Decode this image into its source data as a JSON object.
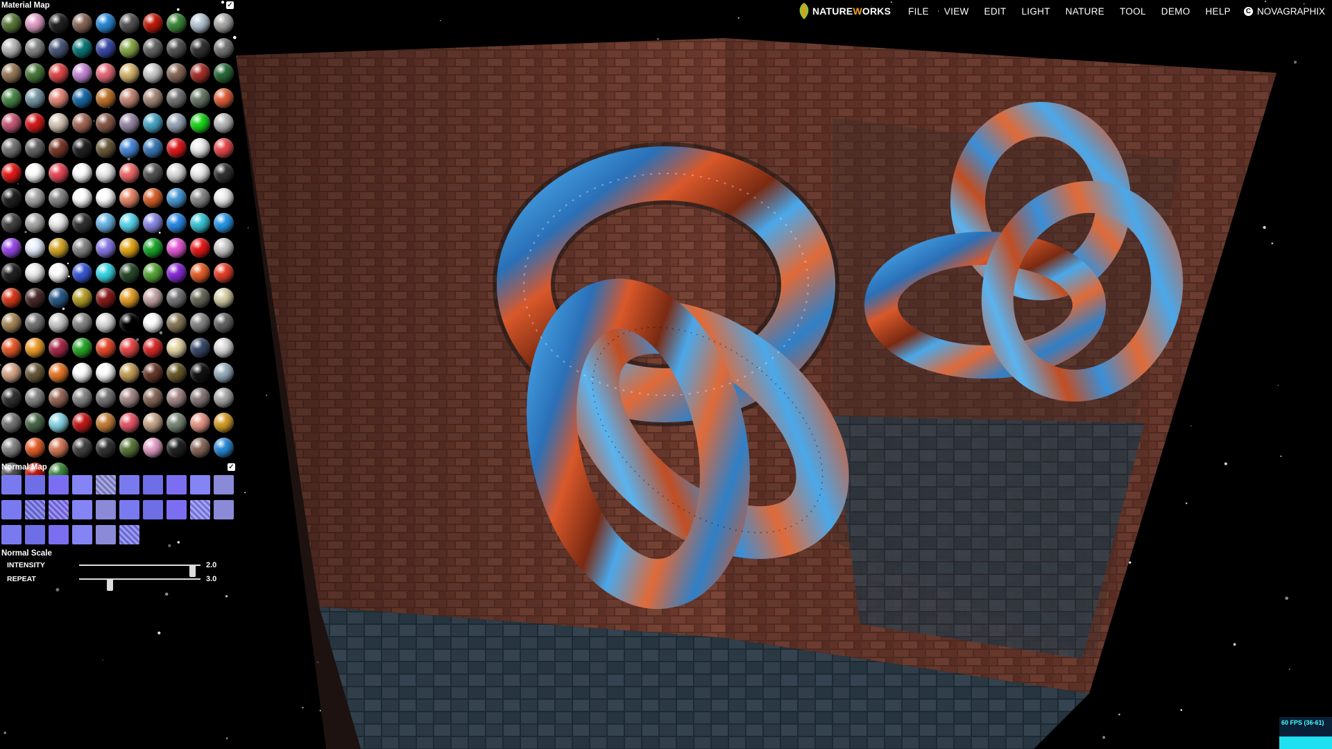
{
  "menu": {
    "logo_prefix": "N",
    "logo_mid": "ATURE",
    "logo_w": "W",
    "logo_end": "ORKS",
    "items": [
      "FILE",
      "VIEW",
      "EDIT",
      "LIGHT",
      "NATURE",
      "TOOL",
      "DEMO",
      "HELP"
    ],
    "brand": "NOVAGRAPHIX"
  },
  "material_map": {
    "title": "Material Map",
    "enabled": true,
    "count": 183
  },
  "normal_map": {
    "title": "Normal Map",
    "enabled": true,
    "count": 26
  },
  "normal_scale": {
    "title": "Normal Scale",
    "intensity": {
      "label": "INTENSITY",
      "value": "2.0",
      "fraction": 0.93
    },
    "repeat": {
      "label": "REPEAT",
      "value": "3.0",
      "fraction": 0.25
    }
  },
  "fps": {
    "text": "60 FPS (36-61)"
  },
  "colors": {
    "accent_cyan": "#1fe0f0",
    "knot_blue": "#3a9be0",
    "knot_orange": "#d85a2a",
    "brick": "#6b3a2a"
  }
}
